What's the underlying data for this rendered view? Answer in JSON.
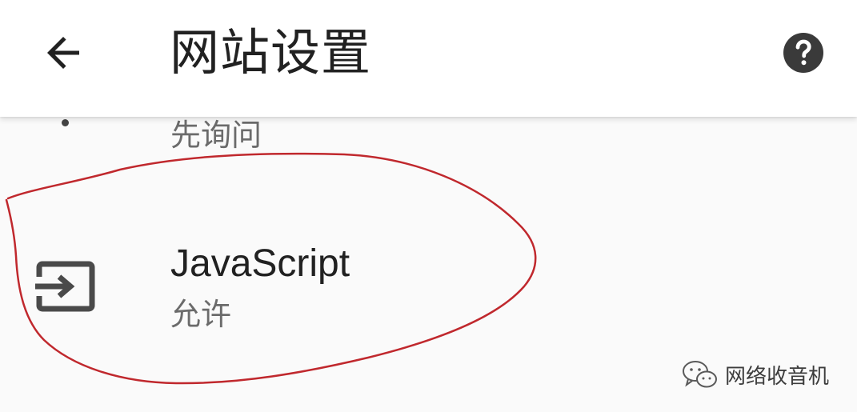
{
  "app_bar": {
    "title": "网站设置",
    "back_icon": "arrow-back-icon",
    "help_icon": "help-circle-icon"
  },
  "settings": {
    "previous_item": {
      "summary": "先询问"
    },
    "javascript": {
      "icon": "exit-to-app-icon",
      "title": "JavaScript",
      "summary": "允许"
    }
  },
  "annotation": {
    "type": "hand-drawn-ellipse",
    "color": "#c0282d"
  },
  "watermark": {
    "icon": "wechat-icon",
    "text": "网络收音机"
  }
}
